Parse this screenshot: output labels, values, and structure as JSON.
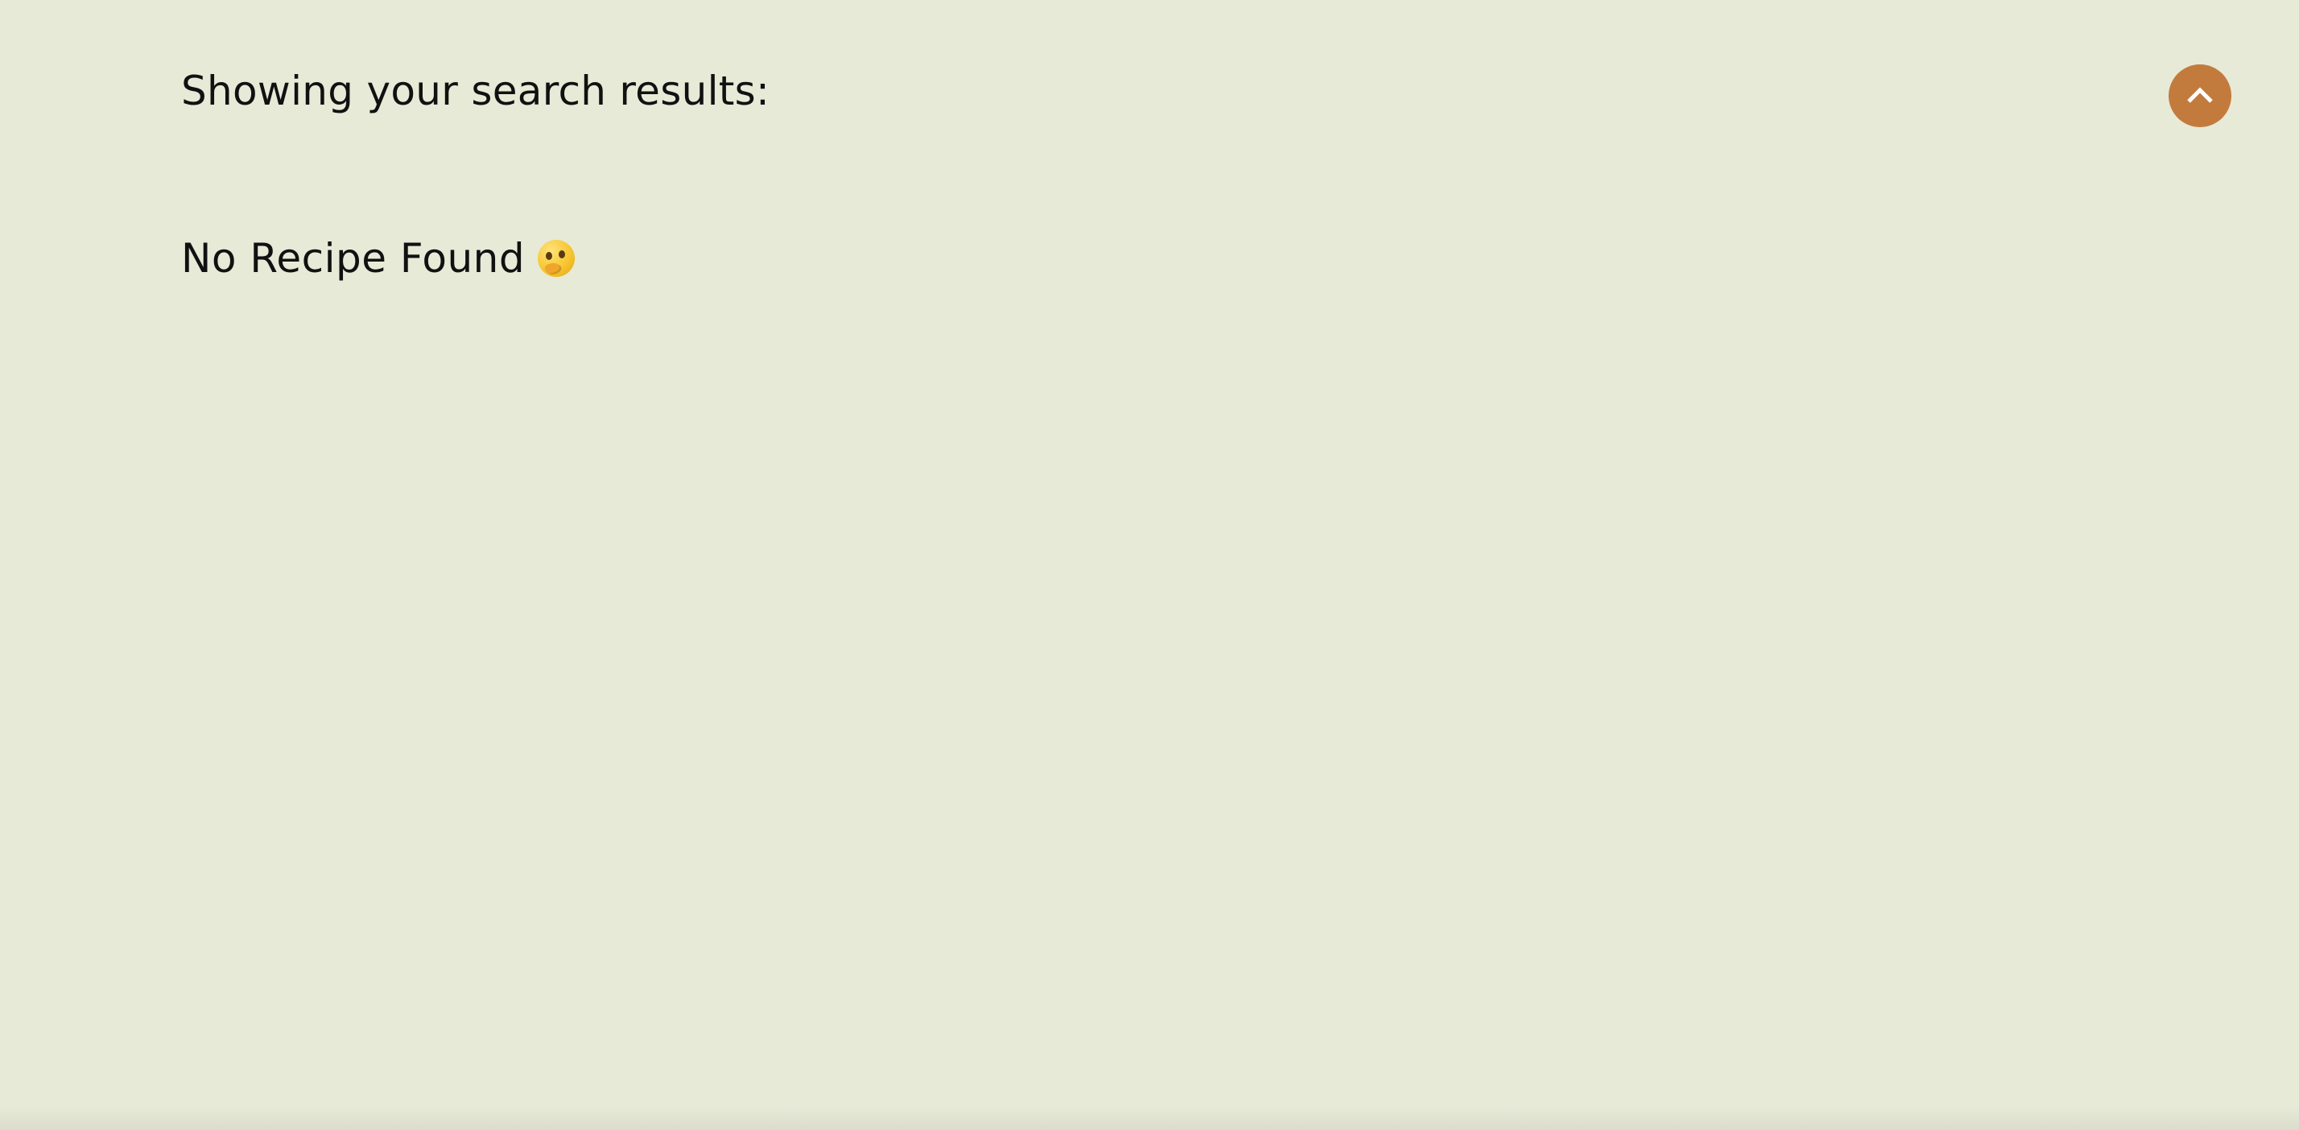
{
  "results": {
    "heading": "Showing your search results:",
    "empty_message": "No Recipe Found"
  },
  "icons": {
    "empty_state_emoji": "thinking-face-icon",
    "scroll_top": "chevron-up-icon"
  },
  "colors": {
    "background": "#e7ead7",
    "accent": "#c37b3d",
    "text": "#111111"
  }
}
